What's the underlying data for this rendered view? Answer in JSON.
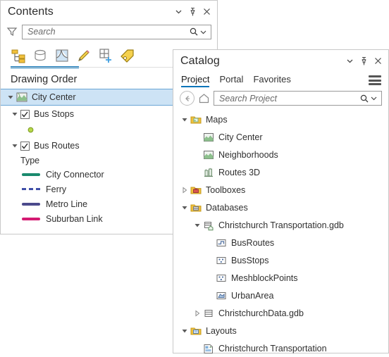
{
  "contents": {
    "title": "Contents",
    "header_buttons": [
      {
        "name": "chevron-down-icon",
        "label": "Menu"
      },
      {
        "name": "pin-icon",
        "label": "Pin"
      },
      {
        "name": "close-icon",
        "label": "Close"
      }
    ],
    "filter_icon": "funnel-icon",
    "search": {
      "placeholder": "Search",
      "value": ""
    },
    "toolbar": [
      {
        "name": "drawing-order-icon",
        "label": "List By Drawing Order",
        "active": true
      },
      {
        "name": "data-source-icon",
        "label": "List By Data Source",
        "active": false
      },
      {
        "name": "selection-icon",
        "label": "List By Selection",
        "active": false
      },
      {
        "name": "editing-icon",
        "label": "List By Editing",
        "active": false
      },
      {
        "name": "snapping-grid-icon",
        "label": "List By Snapping",
        "active": false
      },
      {
        "name": "labeling-tag-icon",
        "label": "List By Labeling",
        "active": false
      }
    ],
    "tree_header": "Drawing Order",
    "map": {
      "label": "City Center",
      "icon": "map-icon",
      "selected": true,
      "expanded": true
    },
    "layers": [
      {
        "label": "Bus Stops",
        "checked": true,
        "expanded": true,
        "symbol_type": "point",
        "point_color": "#aacc33",
        "legend_header": "",
        "legend": []
      },
      {
        "label": "Bus Routes",
        "checked": true,
        "expanded": true,
        "symbol_type": "line",
        "legend_header": "Type",
        "legend": [
          {
            "label": "City Connector",
            "color": "#1a8a6e",
            "style": "solid"
          },
          {
            "label": "Ferry",
            "color": "#3f4fa8",
            "style": "dashed"
          },
          {
            "label": "Metro Line",
            "color": "#4b4a8c",
            "style": "solid"
          },
          {
            "label": "Suburban Link",
            "color": "#d41a72",
            "style": "solid"
          }
        ]
      }
    ]
  },
  "catalog": {
    "title": "Catalog",
    "header_buttons": [
      {
        "name": "chevron-down-icon",
        "label": "Menu"
      },
      {
        "name": "pin-icon",
        "label": "Pin"
      },
      {
        "name": "close-icon",
        "label": "Close"
      }
    ],
    "tabs": [
      {
        "label": "Project",
        "active": true
      },
      {
        "label": "Portal",
        "active": false
      },
      {
        "label": "Favorites",
        "active": false
      }
    ],
    "menu_icon": "hamburger-menu-icon",
    "back_icon": "back-arrow-icon",
    "home_icon": "home-icon",
    "search": {
      "placeholder": "Search Project",
      "value": ""
    },
    "tree": [
      {
        "label": "Maps",
        "icon": "folder-maps-icon",
        "indent": 0,
        "expanded": true,
        "toggle": "expanded"
      },
      {
        "label": "City Center",
        "icon": "map-icon",
        "indent": 1,
        "toggle": "none"
      },
      {
        "label": "Neighborhoods",
        "icon": "map-icon",
        "indent": 1,
        "toggle": "none"
      },
      {
        "label": "Routes 3D",
        "icon": "scene-3d-icon",
        "indent": 1,
        "toggle": "none"
      },
      {
        "label": "Toolboxes",
        "icon": "folder-toolboxes-icon",
        "indent": 0,
        "expanded": false,
        "toggle": "collapsed"
      },
      {
        "label": "Databases",
        "icon": "folder-databases-icon",
        "indent": 0,
        "expanded": true,
        "toggle": "expanded"
      },
      {
        "label": "Christchurch Transportation.gdb",
        "icon": "geodatabase-home-icon",
        "indent": 1,
        "expanded": true,
        "toggle": "expanded"
      },
      {
        "label": "BusRoutes",
        "icon": "line-feature-icon",
        "indent": 2,
        "toggle": "none"
      },
      {
        "label": "BusStops",
        "icon": "point-feature-icon",
        "indent": 2,
        "toggle": "none"
      },
      {
        "label": "MeshblockPoints",
        "icon": "point-feature-icon",
        "indent": 2,
        "toggle": "none"
      },
      {
        "label": "UrbanArea",
        "icon": "polygon-feature-icon",
        "indent": 2,
        "toggle": "none"
      },
      {
        "label": "ChristchurchData.gdb",
        "icon": "geodatabase-icon",
        "indent": 1,
        "expanded": false,
        "toggle": "collapsed"
      },
      {
        "label": "Layouts",
        "icon": "folder-layouts-icon",
        "indent": 0,
        "expanded": true,
        "toggle": "expanded"
      },
      {
        "label": "Christchurch Transportation",
        "icon": "layout-icon",
        "indent": 1,
        "toggle": "none"
      }
    ]
  },
  "colors": {
    "accent": "#0a74b9",
    "selection": "#cde3f5",
    "selection_border": "#6aa6d6",
    "panel_border": "#c8c8c8",
    "folder_yellow": "#f2c13c",
    "text": "#2f2f2f"
  }
}
